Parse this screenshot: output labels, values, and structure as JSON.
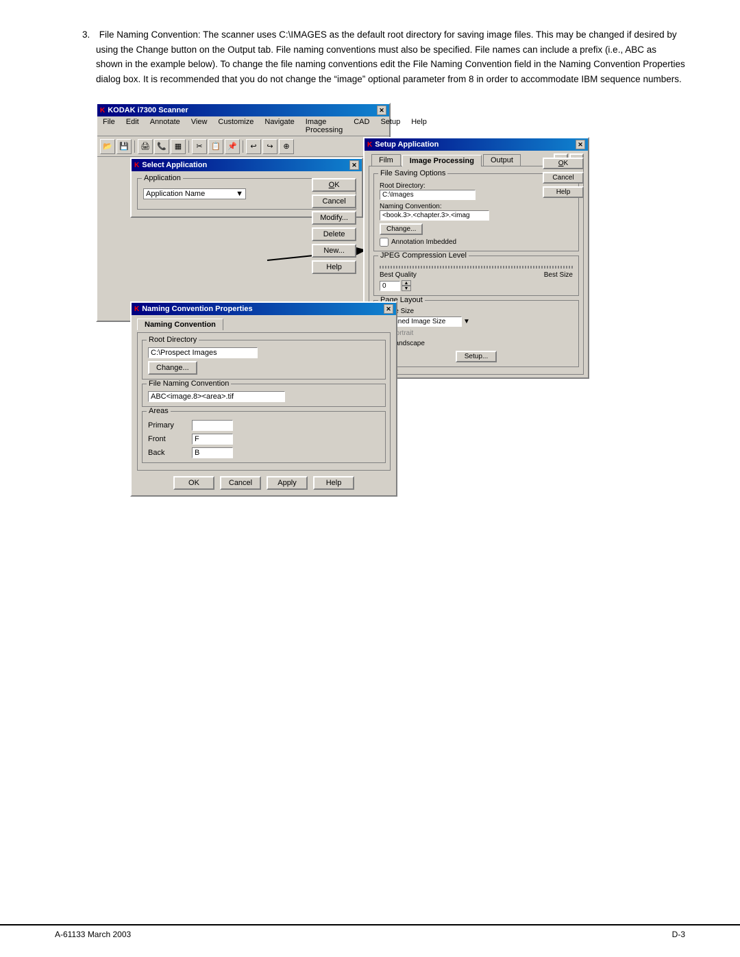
{
  "page": {
    "body_text": "3. File Naming Convention: The scanner uses C:\\IMAGES as the default root directory for saving image files. This may be changed if desired by using the Change button on the Output tab. File naming conventions must also be specified. File names can include a prefix (i.e., ABC as shown in the example below). To change the file naming conventions edit the File Naming Convention field in the Naming Convention Properties dialog box. It is recommended that you do not change the “image” optional parameter from 8 in order to accommodate IBM sequence numbers.",
    "footer_left": "A-61133  March 2003",
    "footer_right": "D-3"
  },
  "scanner_window": {
    "title": "KODAK i7300 Scanner",
    "menu_items": [
      "File",
      "Edit",
      "Annotate",
      "View",
      "Customize",
      "Navigate",
      "Image Processing",
      "CAD",
      "Setup",
      "Help"
    ]
  },
  "select_app_dialog": {
    "title": "Select Application",
    "group_label": "Application",
    "dropdown_label": "Application Name",
    "buttons": [
      "OK",
      "Cancel",
      "Modify...",
      "Delete",
      "New...",
      "Help"
    ]
  },
  "setup_app_dialog": {
    "title": "Setup Application",
    "tabs": [
      "Film",
      "Image Processing",
      "Output"
    ],
    "nav_left": "◄",
    "nav_right": "►",
    "buttons": [
      "OK",
      "Cancel",
      "Help"
    ],
    "file_saving_options": {
      "group_label": "File Saving Options",
      "root_dir_label": "Root Directory:",
      "root_dir_value": "C:\\Images",
      "naming_conv_label": "Naming Convention:",
      "naming_conv_value": "<book.3>.<chapter.3>.<imag",
      "change_btn": "Change...",
      "annotation_checkbox": "Annotation Imbedded"
    },
    "jpeg_compression": {
      "group_label": "JPEG Compression Level",
      "label_left": "Best Quality",
      "label_right": "Best Size",
      "value": "0"
    },
    "page_layout": {
      "group_label": "Page Layout",
      "image_size_label": "Image Size",
      "dropdown_value": "Scanned Image Size",
      "portrait_label": "Portrait",
      "landscape_label": "Landscape",
      "setup_btn": "Setup..."
    }
  },
  "naming_convention_dialog": {
    "title": "Naming Convention Properties",
    "tab": "Naming Convention",
    "root_dir_group": "Root Directory",
    "root_dir_value": "C:\\Prospect Images",
    "change_btn": "Change...",
    "file_naming_group": "File Naming Convention",
    "file_naming_value": "ABC<image.8><area>.tif",
    "areas_group": "Areas",
    "primary_label": "Primary",
    "primary_value": "",
    "front_label": "Front",
    "front_value": "F",
    "back_label": "Back",
    "back_value": "B",
    "buttons": [
      "OK",
      "Cancel",
      "Apply",
      "Help"
    ]
  }
}
